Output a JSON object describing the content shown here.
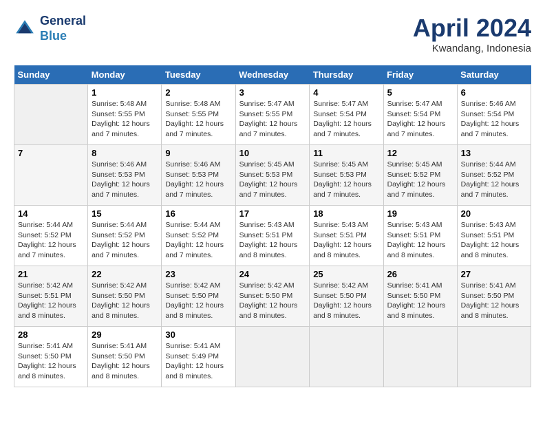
{
  "header": {
    "logo_line1": "General",
    "logo_line2": "Blue",
    "month": "April 2024",
    "location": "Kwandang, Indonesia"
  },
  "weekdays": [
    "Sunday",
    "Monday",
    "Tuesday",
    "Wednesday",
    "Thursday",
    "Friday",
    "Saturday"
  ],
  "weeks": [
    [
      {
        "day": "",
        "info": ""
      },
      {
        "day": "1",
        "info": "Sunrise: 5:48 AM\nSunset: 5:55 PM\nDaylight: 12 hours\nand 7 minutes."
      },
      {
        "day": "2",
        "info": "Sunrise: 5:48 AM\nSunset: 5:55 PM\nDaylight: 12 hours\nand 7 minutes."
      },
      {
        "day": "3",
        "info": "Sunrise: 5:47 AM\nSunset: 5:55 PM\nDaylight: 12 hours\nand 7 minutes."
      },
      {
        "day": "4",
        "info": "Sunrise: 5:47 AM\nSunset: 5:54 PM\nDaylight: 12 hours\nand 7 minutes."
      },
      {
        "day": "5",
        "info": "Sunrise: 5:47 AM\nSunset: 5:54 PM\nDaylight: 12 hours\nand 7 minutes."
      },
      {
        "day": "6",
        "info": "Sunrise: 5:46 AM\nSunset: 5:54 PM\nDaylight: 12 hours\nand 7 minutes."
      }
    ],
    [
      {
        "day": "7",
        "info": ""
      },
      {
        "day": "8",
        "info": "Sunrise: 5:46 AM\nSunset: 5:53 PM\nDaylight: 12 hours\nand 7 minutes."
      },
      {
        "day": "9",
        "info": "Sunrise: 5:46 AM\nSunset: 5:53 PM\nDaylight: 12 hours\nand 7 minutes."
      },
      {
        "day": "10",
        "info": "Sunrise: 5:45 AM\nSunset: 5:53 PM\nDaylight: 12 hours\nand 7 minutes."
      },
      {
        "day": "11",
        "info": "Sunrise: 5:45 AM\nSunset: 5:53 PM\nDaylight: 12 hours\nand 7 minutes."
      },
      {
        "day": "12",
        "info": "Sunrise: 5:45 AM\nSunset: 5:52 PM\nDaylight: 12 hours\nand 7 minutes."
      },
      {
        "day": "13",
        "info": "Sunrise: 5:44 AM\nSunset: 5:52 PM\nDaylight: 12 hours\nand 7 minutes."
      }
    ],
    [
      {
        "day": "14",
        "info": "Sunrise: 5:44 AM\nSunset: 5:52 PM\nDaylight: 12 hours\nand 7 minutes."
      },
      {
        "day": "15",
        "info": "Sunrise: 5:44 AM\nSunset: 5:52 PM\nDaylight: 12 hours\nand 7 minutes."
      },
      {
        "day": "16",
        "info": "Sunrise: 5:44 AM\nSunset: 5:52 PM\nDaylight: 12 hours\nand 7 minutes."
      },
      {
        "day": "17",
        "info": "Sunrise: 5:43 AM\nSunset: 5:51 PM\nDaylight: 12 hours\nand 8 minutes."
      },
      {
        "day": "18",
        "info": "Sunrise: 5:43 AM\nSunset: 5:51 PM\nDaylight: 12 hours\nand 8 minutes."
      },
      {
        "day": "19",
        "info": "Sunrise: 5:43 AM\nSunset: 5:51 PM\nDaylight: 12 hours\nand 8 minutes."
      },
      {
        "day": "20",
        "info": "Sunrise: 5:43 AM\nSunset: 5:51 PM\nDaylight: 12 hours\nand 8 minutes."
      }
    ],
    [
      {
        "day": "21",
        "info": "Sunrise: 5:42 AM\nSunset: 5:51 PM\nDaylight: 12 hours\nand 8 minutes."
      },
      {
        "day": "22",
        "info": "Sunrise: 5:42 AM\nSunset: 5:50 PM\nDaylight: 12 hours\nand 8 minutes."
      },
      {
        "day": "23",
        "info": "Sunrise: 5:42 AM\nSunset: 5:50 PM\nDaylight: 12 hours\nand 8 minutes."
      },
      {
        "day": "24",
        "info": "Sunrise: 5:42 AM\nSunset: 5:50 PM\nDaylight: 12 hours\nand 8 minutes."
      },
      {
        "day": "25",
        "info": "Sunrise: 5:42 AM\nSunset: 5:50 PM\nDaylight: 12 hours\nand 8 minutes."
      },
      {
        "day": "26",
        "info": "Sunrise: 5:41 AM\nSunset: 5:50 PM\nDaylight: 12 hours\nand 8 minutes."
      },
      {
        "day": "27",
        "info": "Sunrise: 5:41 AM\nSunset: 5:50 PM\nDaylight: 12 hours\nand 8 minutes."
      }
    ],
    [
      {
        "day": "28",
        "info": "Sunrise: 5:41 AM\nSunset: 5:50 PM\nDaylight: 12 hours\nand 8 minutes."
      },
      {
        "day": "29",
        "info": "Sunrise: 5:41 AM\nSunset: 5:50 PM\nDaylight: 12 hours\nand 8 minutes."
      },
      {
        "day": "30",
        "info": "Sunrise: 5:41 AM\nSunset: 5:49 PM\nDaylight: 12 hours\nand 8 minutes."
      },
      {
        "day": "",
        "info": ""
      },
      {
        "day": "",
        "info": ""
      },
      {
        "day": "",
        "info": ""
      },
      {
        "day": "",
        "info": ""
      }
    ]
  ]
}
